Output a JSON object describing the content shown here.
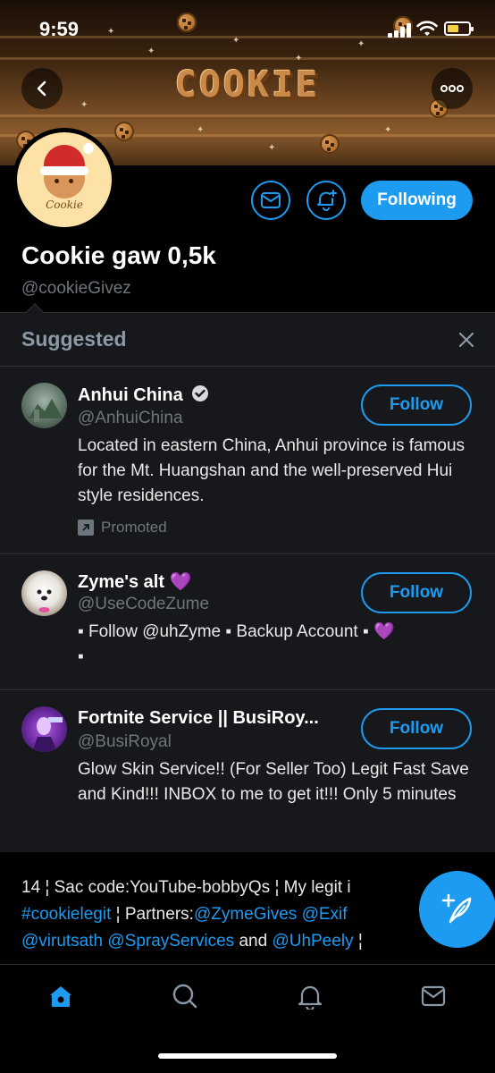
{
  "status_bar": {
    "time": "9:59"
  },
  "banner": {
    "title": "COOKIE"
  },
  "profile": {
    "avatar_text": "Cookie",
    "display_name": "Cookie gaw 0,5k",
    "handle": "@cookieGivez",
    "following_label": "Following"
  },
  "suggested": {
    "title": "Suggested",
    "items": [
      {
        "name": "Anhui China",
        "handle": "@AnhuiChina",
        "bio": "Located in eastern China, Anhui province is famous for the Mt. Huangshan and the well-preserved Hui style residences.",
        "promoted_label": "Promoted",
        "follow_label": "Follow"
      },
      {
        "name": "Zyme's alt",
        "name_emoji": "💜",
        "handle": "@UseCodeZume",
        "bio": "▪ Follow @uhZyme ▪ Backup Account ▪",
        "bio_emoji": "💜",
        "bio_end": "▪",
        "follow_label": "Follow"
      },
      {
        "name": "Fortnite Service || BusiRoy...",
        "handle": "@BusiRoyal",
        "bio": "Glow Skin Service!! (For Seller Too) Legit Fast Save and Kind!!! INBOX to me to get it!!! Only 5 minutes",
        "follow_label": "Follow"
      }
    ]
  },
  "bio_strip": {
    "line1": "14 ¦ Sac code:YouTube-bobbyQs ¦ My legit i",
    "line2_tag": "#cookielegit",
    "line2_text": " ¦ Partners:",
    "line2_m1": "@ZymeGives",
    "line2_m2": " @Exif",
    "line3_m1": "@virutsath",
    "line3_m2": " @SprayServices",
    "line3_and": " and ",
    "line3_m3": "@UhPeely",
    "line3_end": " ¦"
  },
  "colors": {
    "accent": "#1d9bf0",
    "background": "#000000",
    "panel": "#16181c",
    "muted": "#6e767d"
  }
}
